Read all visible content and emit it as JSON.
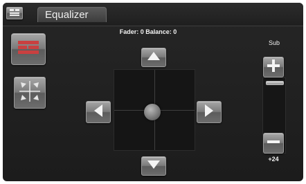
{
  "header": {
    "title": "Equalizer",
    "menu_icon": "menu-grid-icon"
  },
  "status": {
    "text": "Fader: 0 Balance: 0",
    "fader": 0,
    "balance": 0
  },
  "sidebar": {
    "items": [
      {
        "name": "equalizer-mode",
        "icon": "bars-icon"
      },
      {
        "name": "fader-balance-mode",
        "icon": "crossed-arrows-icon"
      }
    ]
  },
  "pad": {
    "fader_position": 0,
    "balance_position": 0,
    "controls": [
      "up-arrow-icon",
      "down-arrow-icon",
      "left-arrow-icon",
      "right-arrow-icon"
    ]
  },
  "subwoofer": {
    "label": "Sub",
    "value_text": "+24",
    "level_fraction": 1.0,
    "plus_icon": "plus-icon",
    "minus_icon": "minus-icon"
  },
  "colors": {
    "background": "#1c1c1c",
    "button": "#7b7b7b",
    "text": "#f2f2f2"
  }
}
